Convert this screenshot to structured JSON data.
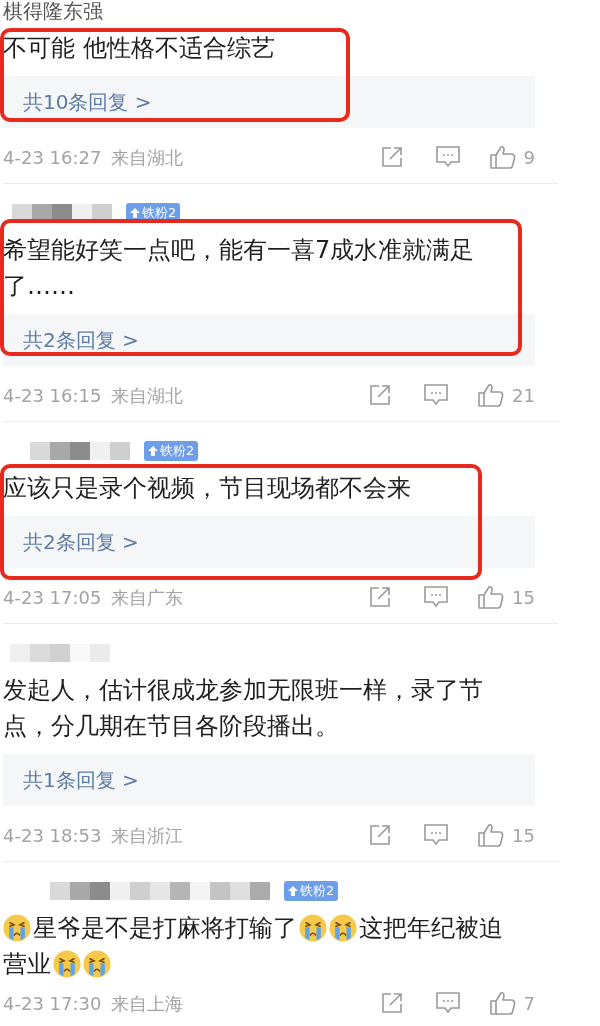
{
  "comments": [
    {
      "username": "棋得隆东强",
      "text": "不可能 他性格不适合综艺",
      "replies": "共10条回复 >",
      "time": "4-23 16:27",
      "location": "来自湖北",
      "likes": "9",
      "highlighted": true
    },
    {
      "badge": "铁粉2",
      "text": "希望能好笑一点吧，能有一喜7成水准就满足了……",
      "replies": "共2条回复 >",
      "time": "4-23 16:15",
      "location": "来自湖北",
      "likes": "21",
      "highlighted": true
    },
    {
      "badge": "铁粉2",
      "text": "应该只是录个视频，节目现场都不会来",
      "replies": "共2条回复 >",
      "time": "4-23 17:05",
      "location": "来自广东",
      "likes": "15",
      "highlighted": true
    },
    {
      "text": "发起人，估计很成龙参加无限班一样，录了节点，分几期在节目各阶段播出。",
      "replies": "共1条回复 >",
      "time": "4-23 18:53",
      "location": "来自浙江",
      "likes": "15",
      "highlighted": false
    },
    {
      "badge": "铁粉2",
      "body_lines": [
        [
          {
            "kind": "emoji"
          },
          {
            "kind": "text",
            "text": "星爷是不是打麻将打输了"
          },
          {
            "kind": "emoji"
          },
          {
            "kind": "emoji"
          },
          {
            "kind": "text",
            "text": "这把年纪被迫"
          }
        ],
        [
          {
            "kind": "text",
            "text": "营业"
          },
          {
            "kind": "emoji"
          },
          {
            "kind": "emoji"
          }
        ]
      ],
      "time": "4-23 17:30",
      "location": "来自上海",
      "likes": "7",
      "highlighted": false
    }
  ]
}
